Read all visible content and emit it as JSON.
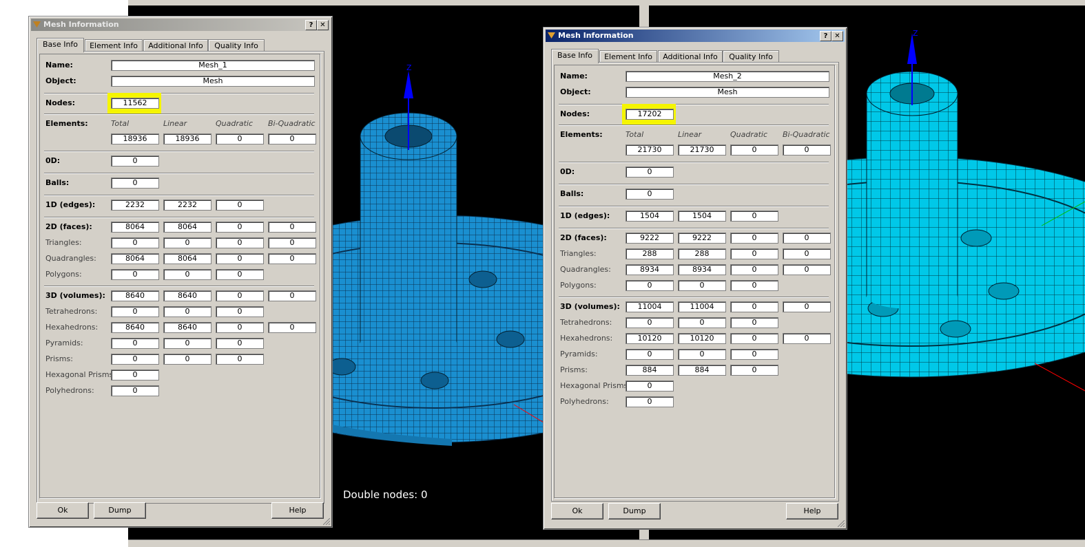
{
  "background": {
    "double_nodes_label": "Double nodes: 0",
    "axis_label": "Z"
  },
  "dialog_left": {
    "title": "Mesh Information",
    "tabs": [
      "Base Info",
      "Element Info",
      "Additional Info",
      "Quality Info"
    ],
    "labels": {
      "name": "Name:",
      "object": "Object:",
      "nodes": "Nodes:",
      "elements": "Elements:",
      "od": "0D:",
      "balls": "Balls:",
      "edges": "1D (edges):",
      "faces": "2D (faces):",
      "triangles": "Triangles:",
      "quadrangles": "Quadrangles:",
      "polygons": "Polygons:",
      "volumes": "3D (volumes):",
      "tetrahedrons": "Tetrahedrons:",
      "hexahedrons": "Hexahedrons:",
      "pyramids": "Pyramids:",
      "prisms": "Prisms:",
      "hex_prisms": "Hexagonal Prisms:",
      "polyhedrons": "Polyhedrons:"
    },
    "headers": [
      "Total",
      "Linear",
      "Quadratic",
      "Bi-Quadratic"
    ],
    "values": {
      "name": "Mesh_1",
      "object": "Mesh",
      "nodes": "11562",
      "elements": [
        "18936",
        "18936",
        "0",
        "0"
      ],
      "od": "0",
      "balls": "0",
      "edges": [
        "2232",
        "2232",
        "0"
      ],
      "faces": [
        "8064",
        "8064",
        "0",
        "0"
      ],
      "triangles": [
        "0",
        "0",
        "0",
        "0"
      ],
      "quadrangles": [
        "8064",
        "8064",
        "0",
        "0"
      ],
      "polygons": [
        "0",
        "0",
        "0"
      ],
      "volumes": [
        "8640",
        "8640",
        "0",
        "0"
      ],
      "tetrahedrons": [
        "0",
        "0",
        "0"
      ],
      "hexahedrons": [
        "8640",
        "8640",
        "0",
        "0"
      ],
      "pyramids": [
        "0",
        "0",
        "0"
      ],
      "prisms": [
        "0",
        "0",
        "0"
      ],
      "hex_prisms": "0",
      "polyhedrons": "0"
    },
    "buttons": {
      "ok": "Ok",
      "dump": "Dump",
      "help": "Help"
    },
    "title_buttons": {
      "help": "?",
      "close": "✕"
    }
  },
  "dialog_right": {
    "title": "Mesh Information",
    "tabs": [
      "Base Info",
      "Element Info",
      "Additional Info",
      "Quality Info"
    ],
    "labels": {
      "name": "Name:",
      "object": "Object:",
      "nodes": "Nodes:",
      "elements": "Elements:",
      "od": "0D:",
      "balls": "Balls:",
      "edges": "1D (edges):",
      "faces": "2D (faces):",
      "triangles": "Triangles:",
      "quadrangles": "Quadrangles:",
      "polygons": "Polygons:",
      "volumes": "3D (volumes):",
      "tetrahedrons": "Tetrahedrons:",
      "hexahedrons": "Hexahedrons:",
      "pyramids": "Pyramids:",
      "prisms": "Prisms:",
      "hex_prisms": "Hexagonal Prisms:",
      "polyhedrons": "Polyhedrons:"
    },
    "headers": [
      "Total",
      "Linear",
      "Quadratic",
      "Bi-Quadratic"
    ],
    "values": {
      "name": "Mesh_2",
      "object": "Mesh",
      "nodes": "17202",
      "elements": [
        "21730",
        "21730",
        "0",
        "0"
      ],
      "od": "0",
      "balls": "0",
      "edges": [
        "1504",
        "1504",
        "0"
      ],
      "faces": [
        "9222",
        "9222",
        "0",
        "0"
      ],
      "triangles": [
        "288",
        "288",
        "0",
        "0"
      ],
      "quadrangles": [
        "8934",
        "8934",
        "0",
        "0"
      ],
      "polygons": [
        "0",
        "0",
        "0"
      ],
      "volumes": [
        "11004",
        "11004",
        "0",
        "0"
      ],
      "tetrahedrons": [
        "0",
        "0",
        "0"
      ],
      "hexahedrons": [
        "10120",
        "10120",
        "0",
        "0"
      ],
      "pyramids": [
        "0",
        "0",
        "0"
      ],
      "prisms": [
        "884",
        "884",
        "0"
      ],
      "hex_prisms": "0",
      "polyhedrons": "0"
    },
    "buttons": {
      "ok": "Ok",
      "dump": "Dump",
      "help": "Help"
    },
    "title_buttons": {
      "help": "?",
      "close": "✕"
    }
  },
  "colors": {
    "mesh_left": "#1a8fd0",
    "mesh_right": "#00d8f0",
    "highlight": "#f5f500",
    "axis_z": "#0000ff",
    "axis_x": "#ff0000",
    "axis_y": "#00c000"
  }
}
